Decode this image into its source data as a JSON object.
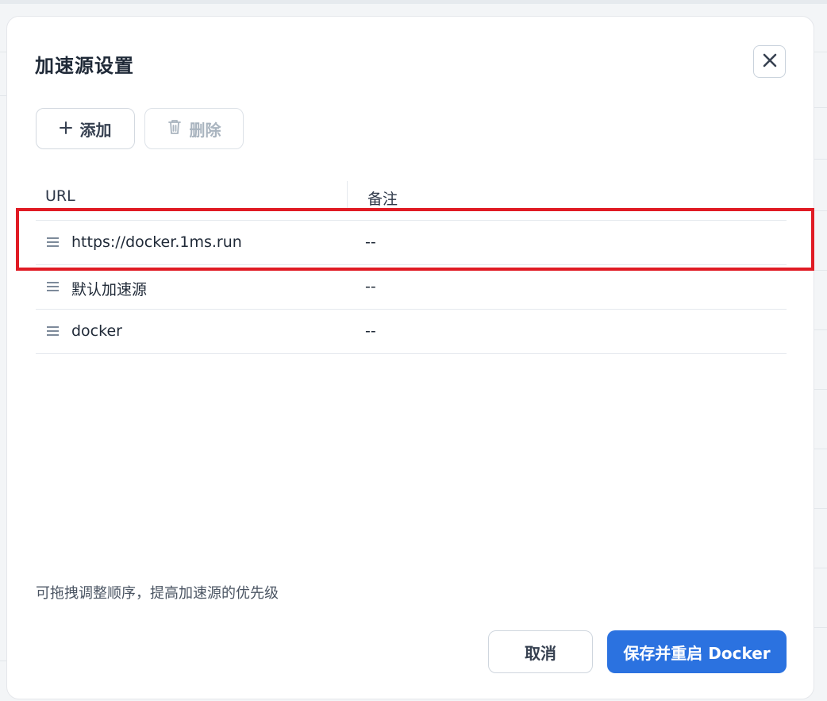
{
  "dialog": {
    "title": "加速源设置",
    "close_icon": "close-icon"
  },
  "toolbar": {
    "add_label": "添加",
    "add_icon": "plus-icon",
    "delete_label": "删除",
    "delete_icon": "trash-icon",
    "delete_disabled": true
  },
  "table": {
    "columns": [
      "URL",
      "备注"
    ],
    "rows": [
      {
        "url": "https://docker.1ms.run",
        "note": "--",
        "highlighted": true
      },
      {
        "url": "默认加速源",
        "note": "--",
        "highlighted": false
      },
      {
        "url": "docker",
        "note": "--",
        "highlighted": false
      }
    ]
  },
  "hint": "可拖拽调整顺序，提高加速源的优先级",
  "footer": {
    "cancel_label": "取消",
    "save_label": "保存并重启 Docker"
  },
  "colors": {
    "primary": "#2b72e0",
    "highlight": "#e01b24",
    "disabled_text": "#a9b4bf"
  }
}
